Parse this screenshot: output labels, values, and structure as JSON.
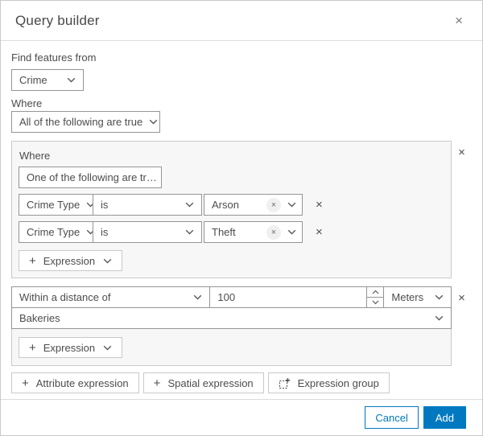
{
  "dialog": {
    "title": "Query builder"
  },
  "icons": {
    "close": "×",
    "plus": "+",
    "chevron_down": "⌄",
    "caret_up": "˄",
    "caret_down": "˅",
    "expression_group": "dashed-square-plus"
  },
  "find_features": {
    "label": "Find features from",
    "layer_value": "Crime"
  },
  "where": {
    "label": "Where",
    "operator_value": "All of the following are true"
  },
  "group1": {
    "label": "Where",
    "operator_value": "One of the following are tr…",
    "clauses": [
      {
        "field": "Crime Type",
        "operator": "is",
        "value": "Arson"
      },
      {
        "field": "Crime Type",
        "operator": "is",
        "value": "Theft"
      }
    ],
    "add_expression_label": "Expression"
  },
  "group2": {
    "spatial_operator": "Within a distance of",
    "distance_value": "100",
    "unit_value": "Meters",
    "layer_value": "Bakeries",
    "add_expression_label": "Expression"
  },
  "actions": {
    "attribute_expression_label": "Attribute expression",
    "spatial_expression_label": "Spatial expression",
    "expression_group_label": "Expression group"
  },
  "footer": {
    "cancel_label": "Cancel",
    "add_label": "Add"
  },
  "colors": {
    "accent": "#0079c1",
    "control_border": "#959595",
    "group_border": "#cacaca",
    "group_background": "#f7f7f7",
    "text": "#4c4c4c"
  }
}
